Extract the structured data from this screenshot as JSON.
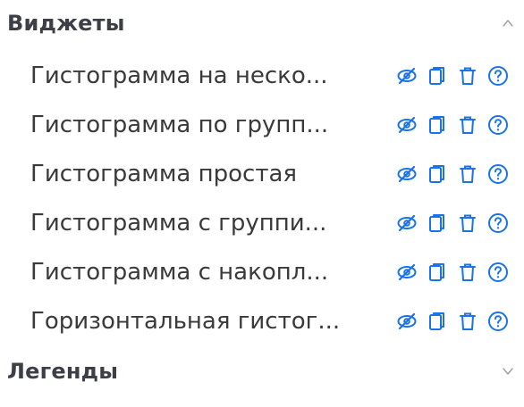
{
  "accent_color": "#1a73e8",
  "sections": {
    "widgets": {
      "title": "Виджеты",
      "state": "expanded",
      "items": [
        {
          "label": "Гистограмма на неско..."
        },
        {
          "label": "Гистограмма по групп..."
        },
        {
          "label": "Гистограмма простая"
        },
        {
          "label": "Гистограмма с группи..."
        },
        {
          "label": "Гистограмма с накопл..."
        },
        {
          "label": "Горизонтальная гистог..."
        }
      ],
      "item_actions": [
        "eye-slash-icon",
        "copy-icon",
        "trash-icon",
        "help-icon"
      ]
    },
    "legends": {
      "title": "Легенды",
      "state": "collapsed"
    }
  }
}
